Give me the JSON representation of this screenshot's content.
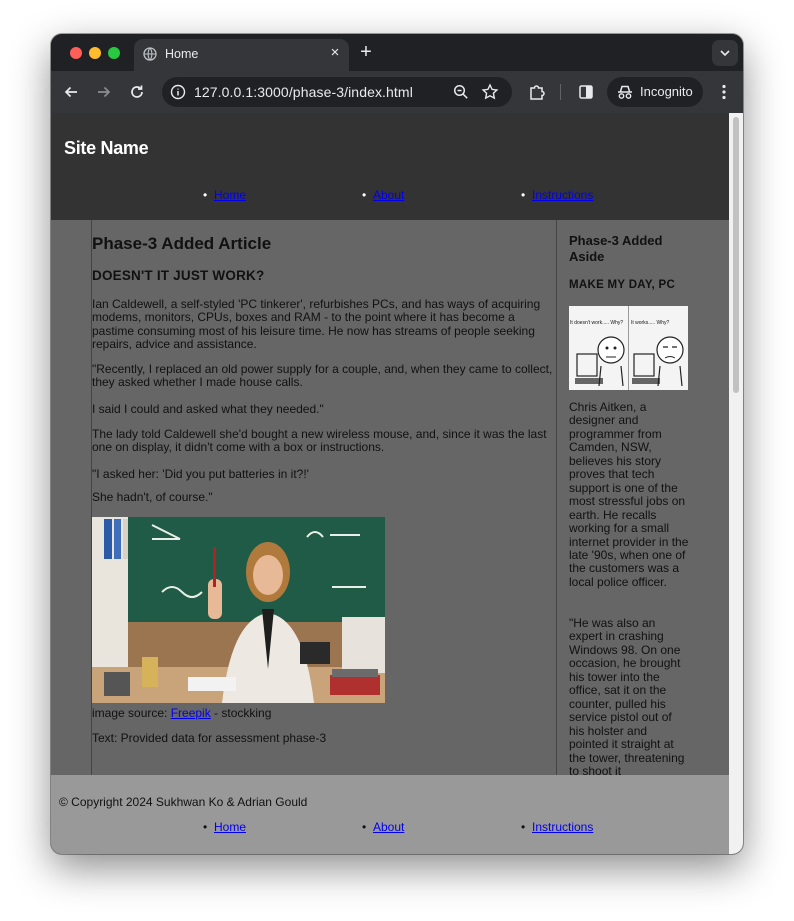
{
  "browser": {
    "tab_title": "Home",
    "tab_close": "×",
    "new_tab": "+",
    "url": "127.0.0.1:3000/phase-3/index.html",
    "incognito_label": "Incognito"
  },
  "site": {
    "name": "Site Name",
    "nav": [
      "Home",
      "About",
      "Instructions"
    ]
  },
  "article": {
    "title": "Phase-3 Added Article",
    "subtitle": "DOESN'T IT JUST WORK?",
    "paragraphs": [
      "Ian Caldewell, a self-styled 'PC tinkerer', refurbishes PCs, and has ways of acquiring modems, monitors, CPUs, boxes and RAM - to the point where it has become a pastime consuming most of his leisure time. He now has streams of people seeking repairs, advice and assistance.",
      "\"Recently, I replaced an old power supply for a couple, and, when they came to collect, they asked whether I made house calls.",
      "I said I could and asked what they needed.\"",
      "The lady told Caldewell she'd bought a new wireless mouse, and, since it was the last one on display, it didn't come with a box or instructions.",
      "\"I asked her: 'Did you put batteries in it?!'",
      "She hadn't, of course.\""
    ],
    "image_source_prefix": "image source: ",
    "image_source_link": "Freepik",
    "image_source_suffix": " - stockking",
    "text_source": "Text: Provided data for assessment phase-3"
  },
  "aside": {
    "title": "Phase-3 Added Aside",
    "subtitle": "MAKE MY DAY, PC",
    "meme_left_caption": "It doesn't work..... Why?",
    "meme_right_caption": "It works..... Why?",
    "paragraph1": "Chris Aitken, a designer and programmer from Camden, NSW, believes his story proves that tech support is one of the most stressful jobs on earth. He recalls working for a small internet provider in the late '90s, when one of the customers was a local police officer.",
    "paragraph2": "\"He was also an expert in crashing Windows 98. On one occasion, he brought his tower into the office, sat it on the counter, pulled his service pistol out of his holster and pointed it straight at the tower, threatening to shoot it"
  },
  "footer": {
    "copyright": "© Copyright 2024 Sukhwan Ko & Adrian Gould",
    "nav": [
      "Home",
      "About",
      "Instructions"
    ]
  },
  "colors": {
    "header_bg": "#333333",
    "main_bg": "#666666",
    "footer_bg": "#999999",
    "link": "#0000ee"
  },
  "icons": [
    "globe-icon",
    "close-icon",
    "plus-icon",
    "chevron-down-icon",
    "back-icon",
    "forward-icon",
    "reload-icon",
    "site-info-icon",
    "zoom-icon",
    "star-icon",
    "extensions-icon",
    "side-panel-icon",
    "incognito-icon",
    "menu-icon"
  ]
}
